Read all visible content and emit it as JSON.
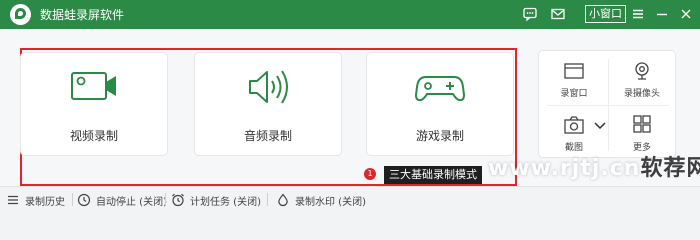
{
  "app": {
    "title": "数据蛙录屏软件"
  },
  "titlebar": {
    "icons": [
      "chat-icon",
      "email-icon",
      "menu-icon",
      "minimize-icon",
      "close-icon"
    ],
    "mini_window_label": "小窗口"
  },
  "modes": [
    {
      "label": "视频录制",
      "icon": "video-camera-icon"
    },
    {
      "label": "音频录制",
      "icon": "speaker-icon"
    },
    {
      "label": "游戏录制",
      "icon": "gamepad-icon"
    }
  ],
  "tools": [
    {
      "label": "录窗口",
      "icon": "window-icon"
    },
    {
      "label": "录摄像头",
      "icon": "webcam-icon"
    },
    {
      "label": "截图",
      "icon": "camera-icon"
    },
    {
      "label": "更多",
      "icon": "grid-icon"
    }
  ],
  "tooltip": {
    "badge": "1",
    "text": "三大基础录制模式"
  },
  "watermark": {
    "text_light": "www.rjtj.cn",
    "text_dark": "软荐网"
  },
  "statusbar": {
    "items": [
      {
        "label": "录制历史",
        "icon": "list-icon"
      },
      {
        "label": "自动停止 (关闭)",
        "icon": "clock-icon"
      },
      {
        "label": "计划任务 (关闭)",
        "icon": "alarm-icon"
      },
      {
        "label": "录制水印 (关闭)",
        "icon": "droplet-icon"
      }
    ]
  },
  "colors": {
    "brand": "#2a8a46",
    "highlight_border": "#e0262d",
    "icon_green": "#2a8a46"
  }
}
